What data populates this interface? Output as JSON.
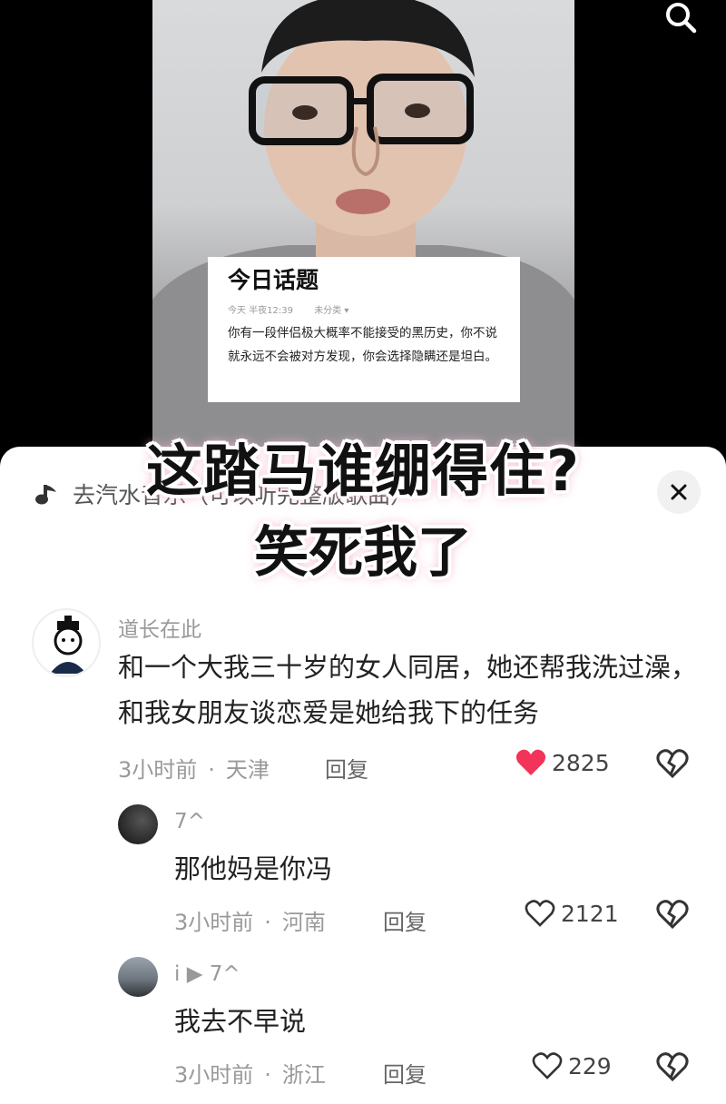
{
  "video": {
    "topic_card": {
      "title": "今日话题",
      "meta_time": "今天 半夜12:39",
      "meta_category": "未分类 ▾",
      "text": "你有一段伴侣极大概率不能接受的黑历史，你不说就永远不会被对方发现，你会选择隐瞒还是坦白。"
    },
    "icons": {
      "search": "search-icon"
    }
  },
  "overlay": {
    "line1": "这踏马谁绷得住?",
    "line2": "笑死我了"
  },
  "sheet": {
    "music_title": "去汽水音乐（可以听完整版歌曲）",
    "icons": {
      "music": "music-note-icon",
      "close": "close-icon"
    }
  },
  "comments": [
    {
      "user": "道长在此",
      "text": "和一个大我三十岁的女人同居，她还帮我洗过澡，和我女朋友谈恋爱是她给我下的任务",
      "time": "3小时前",
      "location": "天津",
      "reply": "回复",
      "likes": "2825",
      "liked": true
    },
    {
      "user": "7^",
      "text": "那他妈是你冯",
      "time": "3小时前",
      "location": "河南",
      "reply": "回复",
      "likes": "2121",
      "liked": false
    },
    {
      "user": "i ▶ 7^",
      "text": "我去不早说",
      "time": "3小时前",
      "location": "浙江",
      "reply": "回复",
      "likes": "229",
      "liked": false
    }
  ],
  "colors": {
    "liked_heart": "#f2345b",
    "sheet_bg": "#ffffff",
    "meta_gray": "#999999"
  }
}
